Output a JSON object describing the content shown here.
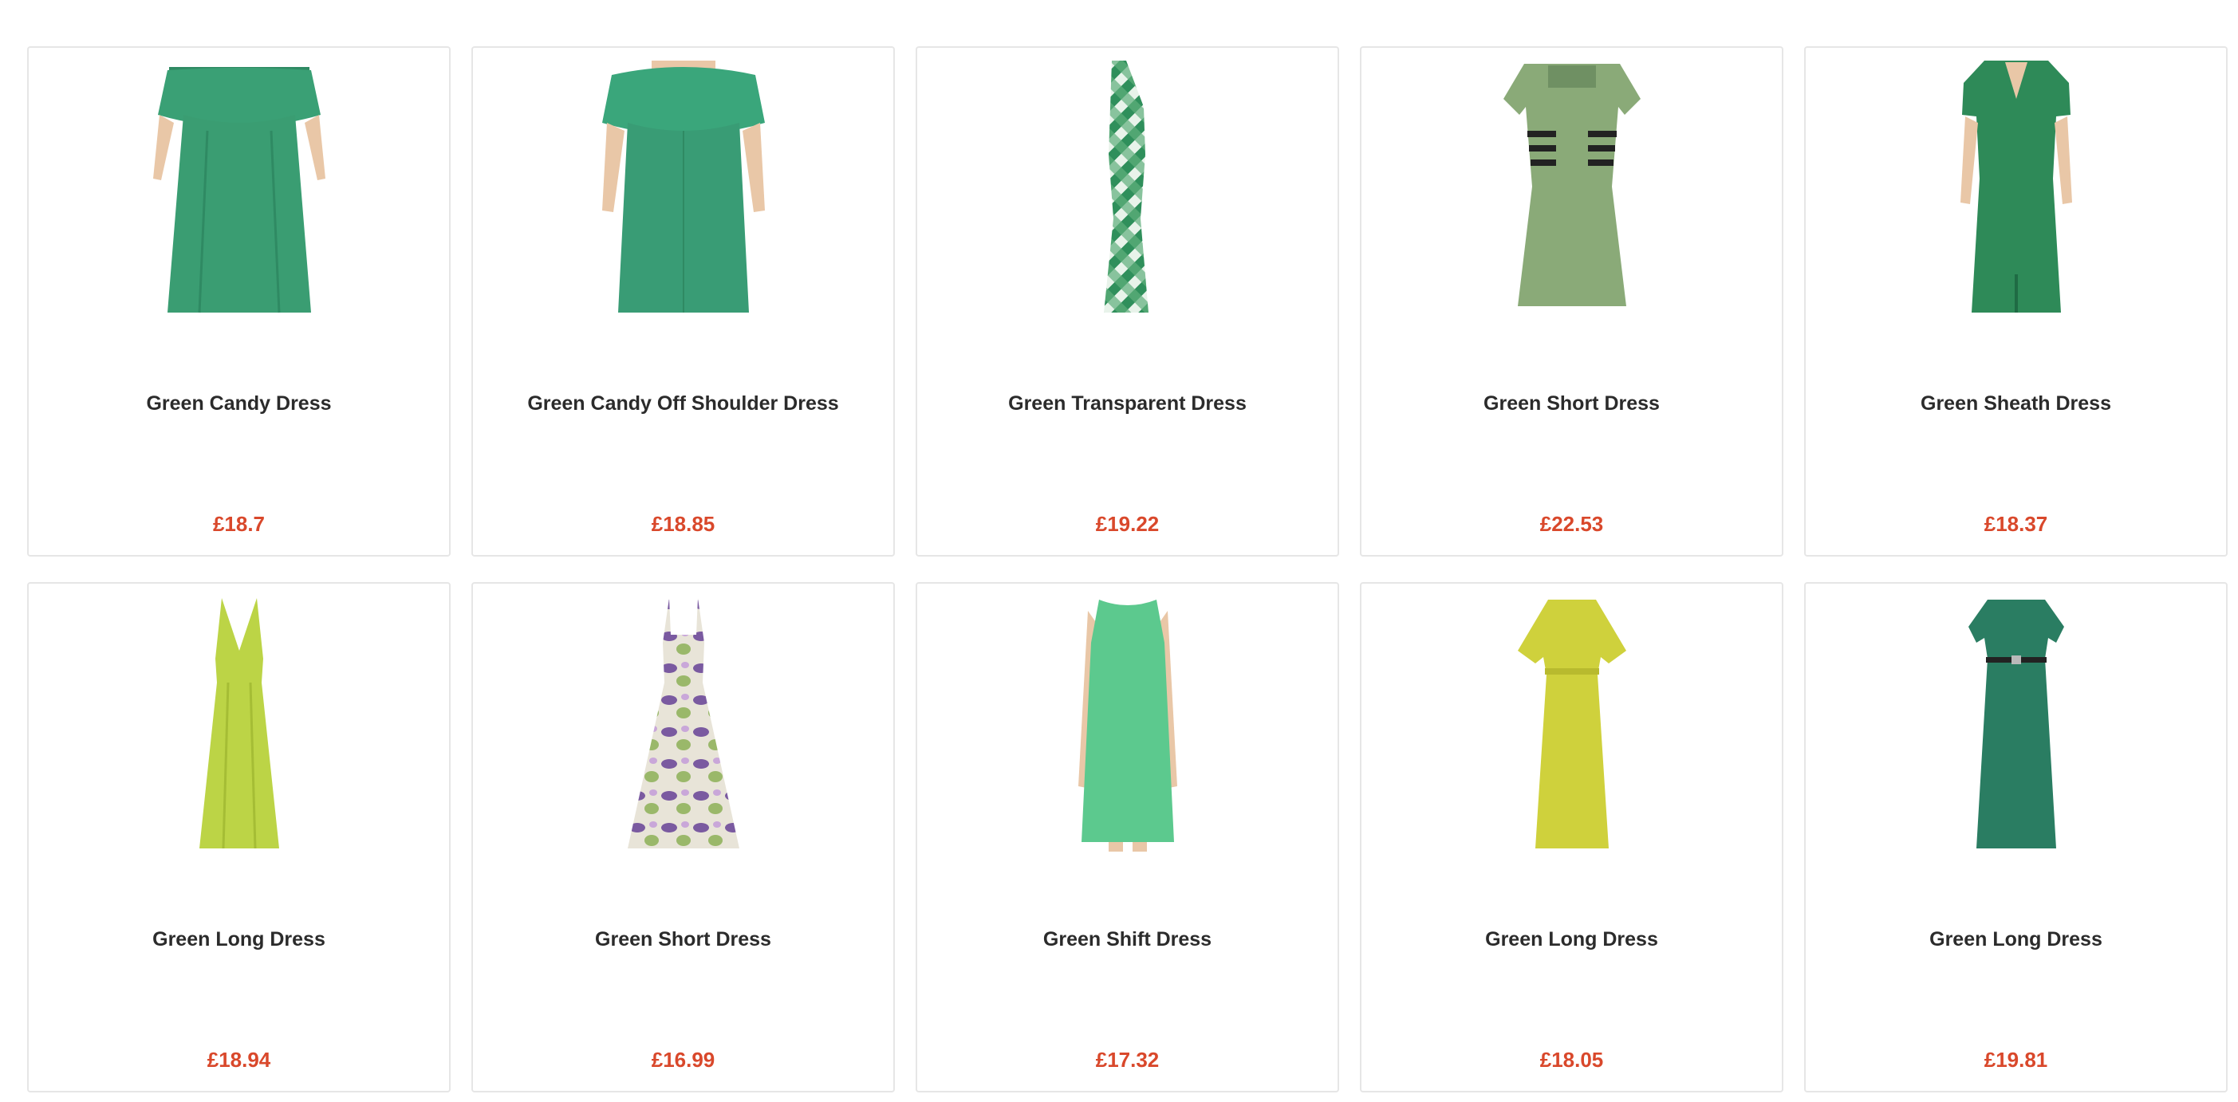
{
  "products": [
    {
      "name": "Green Candy Dress",
      "price": "£18.7",
      "image": "dress-image",
      "color": "#3a9d72"
    },
    {
      "name": "Green Candy Off Shoulder Dress",
      "price": "£18.85",
      "image": "dress-image",
      "color": "#399c75"
    },
    {
      "name": "Green Transparent Dress",
      "price": "£19.22",
      "image": "dress-image",
      "color": "#2f8f5b"
    },
    {
      "name": "Green Short Dress",
      "price": "£22.53",
      "image": "dress-image",
      "color": "#8aaa78"
    },
    {
      "name": "Green Sheath Dress",
      "price": "£18.37",
      "image": "dress-image",
      "color": "#2e8a58"
    },
    {
      "name": "Green Long Dress",
      "price": "£18.94",
      "image": "dress-image",
      "color": "#bcd446"
    },
    {
      "name": "Green Short Dress",
      "price": "£16.99",
      "image": "dress-image",
      "color": "#9d86b8"
    },
    {
      "name": "Green Shift Dress",
      "price": "£17.32",
      "image": "dress-image",
      "color": "#5cc98e"
    },
    {
      "name": "Green Long Dress",
      "price": "£18.05",
      "image": "dress-image",
      "color": "#cfd13c"
    },
    {
      "name": "Green Long Dress",
      "price": "£19.81",
      "image": "dress-image",
      "color": "#2a7d62"
    }
  ]
}
